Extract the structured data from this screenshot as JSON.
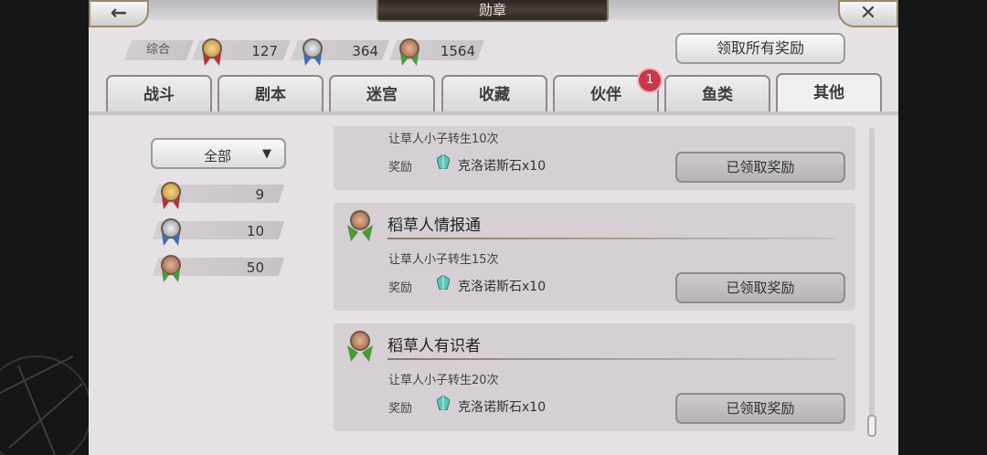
{
  "header": {
    "title": "勋章",
    "back_icon": "←",
    "close_icon": "✕"
  },
  "summary": {
    "label": "综合",
    "counts": [
      {
        "medal": "gold-medal",
        "value": "127"
      },
      {
        "medal": "silver-medal",
        "value": "364"
      },
      {
        "medal": "bronze-medal",
        "value": "1564"
      }
    ],
    "claim_all_label": "领取所有奖励"
  },
  "tabs": [
    {
      "label": "战斗"
    },
    {
      "label": "剧本"
    },
    {
      "label": "迷宫"
    },
    {
      "label": "收藏"
    },
    {
      "label": "伙伴",
      "badge": "1"
    },
    {
      "label": "鱼类"
    },
    {
      "label": "其他",
      "active": true
    }
  ],
  "filter": {
    "selected": "全部",
    "arrow": "▼"
  },
  "left_counts": [
    {
      "medal": "gold-medal",
      "value": "9"
    },
    {
      "medal": "silver-medal",
      "value": "10"
    },
    {
      "medal": "bronze-medal",
      "value": "50"
    }
  ],
  "achievements": [
    {
      "title": "",
      "desc": "让草人小子转生10次",
      "reward_label": "奖励",
      "reward": "克洛诺斯石x10",
      "button": "已领取奖励"
    },
    {
      "title": "稻草人情报通",
      "desc": "让草人小子转生15次",
      "reward_label": "奖励",
      "reward": "克洛诺斯石x10",
      "button": "已领取奖励"
    },
    {
      "title": "稻草人有识者",
      "desc": "让草人小子转生20次",
      "reward_label": "奖励",
      "reward": "克洛诺斯石x10",
      "button": "已领取奖励"
    }
  ],
  "colors": {
    "gold": "#c9a24a",
    "silver": "#9fa6ad",
    "bronze": "#b27a5c",
    "ribbon_red": "#b2303a",
    "ribbon_blue": "#3a6fb5",
    "ribbon_green": "#4a9a3a",
    "badge": "#c8394a"
  }
}
